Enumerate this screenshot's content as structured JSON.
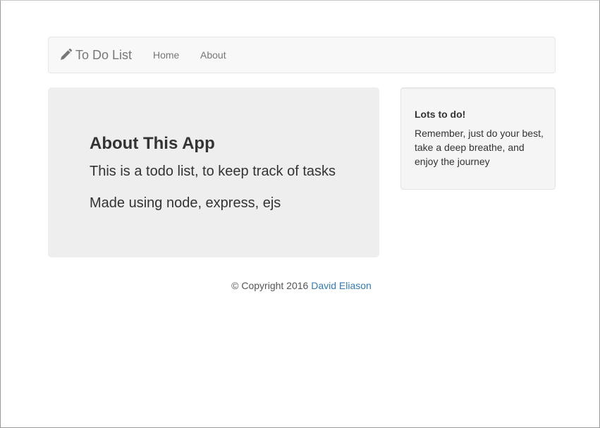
{
  "navbar": {
    "brand_label": "To Do List",
    "brand_icon": "pencil-icon",
    "links": [
      {
        "label": "Home"
      },
      {
        "label": "About"
      }
    ]
  },
  "jumbotron": {
    "title": "About This App",
    "lines": [
      "This is a todo list, to keep track of tasks",
      "Made using node, express, ejs"
    ]
  },
  "sidebar": {
    "title": "Lots to do!",
    "text": "Remember, just do your best, take a deep breathe, and enjoy the journey"
  },
  "footer": {
    "copyright_text": "© Copyright 2016",
    "author_link": "David Eliason"
  },
  "colors": {
    "link": "#337ab7",
    "navbar_bg": "#f8f8f8",
    "jumbotron_bg": "#eeeeee",
    "well_bg": "#f5f5f5"
  }
}
